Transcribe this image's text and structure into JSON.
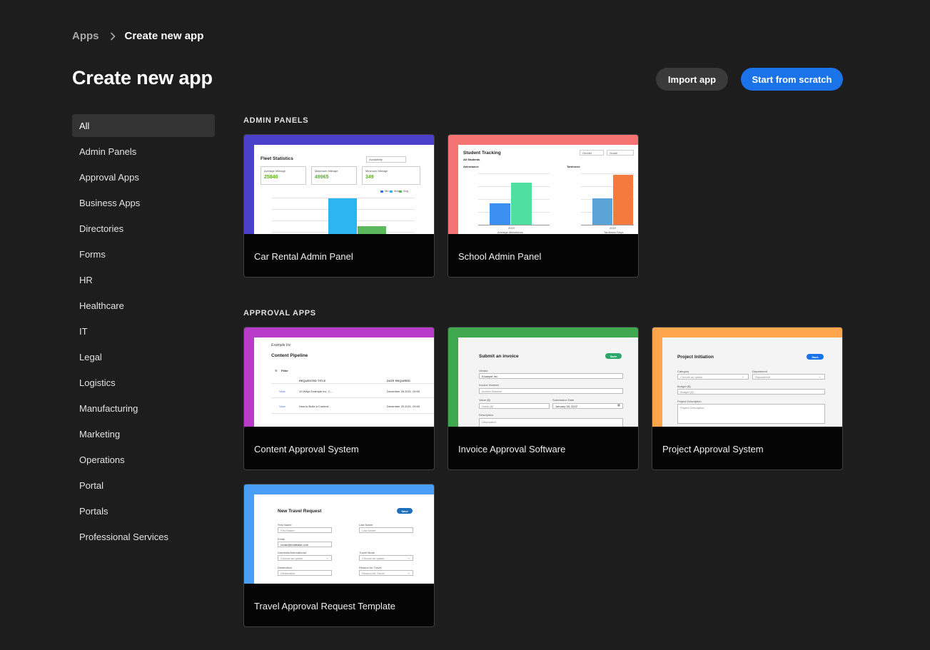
{
  "breadcrumb": {
    "parent": "Apps",
    "current": "Create new app"
  },
  "page_title": "Create new app",
  "actions": {
    "import_label": "Import app",
    "scratch_label": "Start from scratch"
  },
  "colors": {
    "background": "#1d1d1d",
    "primary": "#1a73e8",
    "secondary_button": "#3a3a3a"
  },
  "sidebar": {
    "items": [
      {
        "label": "All",
        "active": true
      },
      {
        "label": "Admin Panels"
      },
      {
        "label": "Approval Apps"
      },
      {
        "label": "Business Apps"
      },
      {
        "label": "Directories"
      },
      {
        "label": "Forms"
      },
      {
        "label": "HR"
      },
      {
        "label": "Healthcare"
      },
      {
        "label": "IT"
      },
      {
        "label": "Legal"
      },
      {
        "label": "Logistics"
      },
      {
        "label": "Manufacturing"
      },
      {
        "label": "Marketing"
      },
      {
        "label": "Operations"
      },
      {
        "label": "Portal"
      },
      {
        "label": "Portals"
      },
      {
        "label": "Professional Services"
      }
    ]
  },
  "sections": {
    "admin": {
      "heading": "ADMIN PANELS",
      "cards": [
        {
          "title": "Car Rental Admin Panel",
          "accent": "#4b40c9",
          "preview": {
            "title": "Fleet Statistics",
            "dropdown": "Availability",
            "stats": [
              {
                "label": "Average Mileage",
                "value": "25840"
              },
              {
                "label": "Maximum Mileage",
                "value": "49965"
              },
              {
                "label": "Minimum Mileage",
                "value": "349"
              }
            ],
            "legend": [
              "Min",
              "Max",
              "Avg"
            ]
          }
        },
        {
          "title": "School Admin Panel",
          "accent": "#f57373",
          "preview": {
            "title": "Student Tracking",
            "subtitle": "All Students",
            "filter1": "Gender",
            "filter2": "Grade",
            "chart1_title": "Attendance",
            "chart2_title": "Tardiness",
            "chart1_caption": "Average Attendance",
            "chart2_caption": "Tardiness Days",
            "axis_label": "2019"
          }
        }
      ]
    },
    "approval": {
      "heading": "APPROVAL APPS",
      "cards": [
        {
          "title": "Content Approval System",
          "accent": "#b93bc9",
          "preview": {
            "company": "Example Inc",
            "title": "Content Pipeline",
            "filter": "Filter",
            "col1": "REQUESTED TITLE",
            "col2": "DATE REQUIRED",
            "rows": [
              {
                "action": "View",
                "title": "10 Ways Example Inc. C...",
                "date": "December 28 2021, 00:00"
              },
              {
                "action": "View",
                "title": "How to Build a Content...",
                "date": "December 29 2021, 00:00"
              }
            ]
          }
        },
        {
          "title": "Invoice Approval Software",
          "accent": "#3fa84f",
          "preview": {
            "title": "Submit an invoice",
            "save": "Save",
            "vendor_label": "Vendor",
            "vendor_value": "Example Inc",
            "invoice_label": "Invoice Number",
            "invoice_placeholder": "Invoice Number",
            "value_label": "Value ($)",
            "value_placeholder": "Value ($)",
            "date_label": "Submission Date",
            "date_value": "January 28, 2022",
            "desc_label": "Description",
            "desc_placeholder": "Description"
          }
        },
        {
          "title": "Project Approval System",
          "accent": "#ffa64d",
          "preview": {
            "title": "Project Initiation",
            "save": "Save",
            "category_label": "Category",
            "category_placeholder": "Choose an option",
            "department_label": "Department",
            "department_placeholder": "Department",
            "budget_label": "Budget ($)",
            "budget_placeholder": "Budget ($)",
            "desc_label": "Project Description",
            "desc_placeholder": "Project Description"
          }
        }
      ]
    },
    "extra": {
      "cards": [
        {
          "title": "Travel Approval Request Template",
          "accent": "#4a9ef5",
          "preview": {
            "title": "New Travel Request",
            "save": "Save",
            "first_label": "First Name",
            "first_placeholder": "First Name",
            "last_label": "Last Name",
            "last_placeholder": "Last Name",
            "email_label": "Email",
            "email_value": "ronan@budibase.com",
            "dom_label": "Domestic/International",
            "dom_placeholder": "Choose an option",
            "mode_label": "Travel Mode",
            "mode_placeholder": "Choose an option",
            "dest_label": "Destination",
            "dest_placeholder": "Destination",
            "reason_label": "Reason for Travel",
            "reason_placeholder": "Reason for Travel"
          }
        }
      ]
    }
  }
}
